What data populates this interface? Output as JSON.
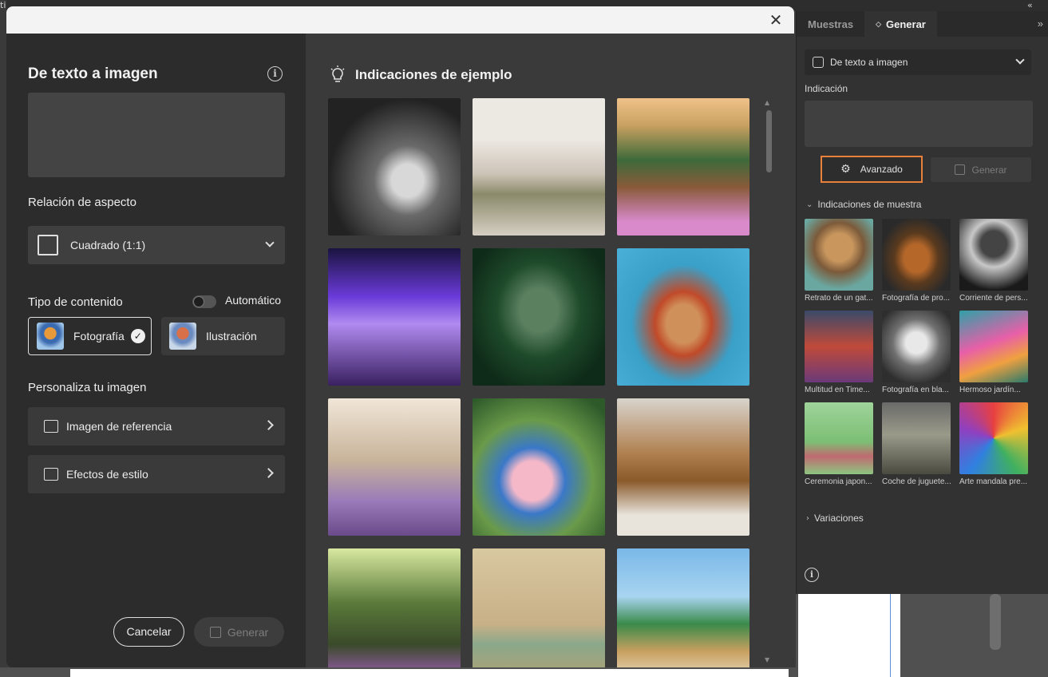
{
  "dialog": {
    "title": "De texto a imagen",
    "close_glyph": "✕",
    "info_glyph": "i",
    "aspect_label": "Relación de aspecto",
    "aspect_value": "Cuadrado (1:1)",
    "content_type_label": "Tipo de contenido",
    "auto_label": "Automático",
    "content_types": [
      "Fotografía",
      "Ilustración"
    ],
    "selected_content_type": "Fotografía",
    "check_glyph": "✓",
    "customize_label": "Personaliza tu imagen",
    "reference_image_label": "Imagen de referencia",
    "style_effects_label": "Efectos de estilo",
    "cancel_label": "Cancelar",
    "generate_label": "Generar",
    "examples_title": "Indicaciones de ejemplo"
  },
  "panel": {
    "tabs": [
      "Muestras",
      "Generar"
    ],
    "active_tab": "Generar",
    "tab_dot": "◇",
    "collapse_glyph": "»",
    "mode_select": "De texto a imagen",
    "prompt_label": "Indicación",
    "advanced_label": "Avanzado",
    "gear_glyph": "⚙",
    "generate_label": "Generar",
    "samples_label": "Indicaciones de muestra",
    "samples_tri": "⌄",
    "samples": [
      "Retrato de un gat...",
      "Fotografía de pro...",
      "Corriente de pers...",
      "Multitud en Time...",
      "Fotografía en bla...",
      "Hermoso jardín...",
      "Ceremonia japon...",
      "Coche de juguete...",
      "Arte mandala pre..."
    ],
    "variations_label": "Variaciones",
    "variations_tri": "›",
    "info_glyph": "i"
  },
  "chrome": {
    "top_left_glyph": "ti",
    "top_right_glyph": "«"
  }
}
